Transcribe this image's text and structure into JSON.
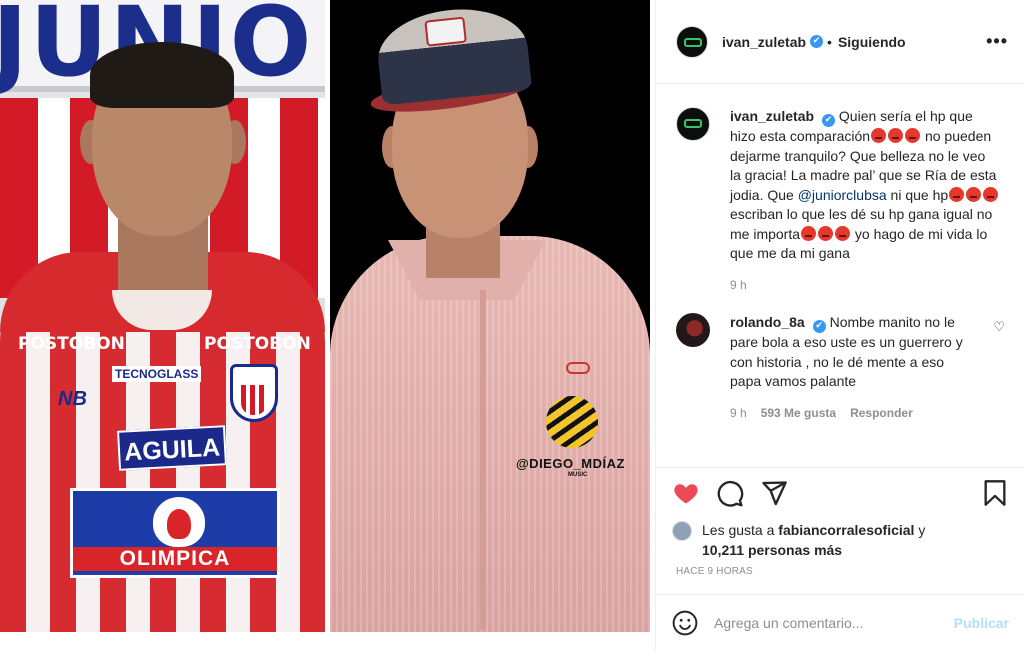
{
  "post_author": {
    "username": "ivan_zuletab",
    "verified_glyph": "✔",
    "separator": "•",
    "follow_status": "Siguiendo",
    "more_icon": "more-horizontal-icon"
  },
  "image": {
    "left_sign": "JUNIO",
    "sponsor_top_left": "POSTOBON",
    "sponsor_top_right": "POSTOBON",
    "sponsor_mid": "TECNOGLASS",
    "brand": "NB",
    "sponsor_chest": "AGUILA",
    "sponsor_main": "OLIMPICA",
    "watermark": "@DIEGO_MDÍAZ",
    "watermark_sub": "MUSIC"
  },
  "caption": {
    "username": "ivan_zuletab",
    "part1": "Quien sería el hp que hizo esta comparación",
    "part2": " no pueden dejarme tranquilo? Que belleza no le veo la gracia! La madre pal’ que se Ría de esta jodia. Que ",
    "mention": "@juniorclubsa",
    "part3": " ni que hp",
    "part4": " escriban lo que les dé su hp gana igual no me importa",
    "part5": " yo hago de mi vida lo que me da mi gana",
    "time": "9 h"
  },
  "comment": {
    "username": "rolando_8a",
    "text": "Nombe manito no le pare bola a eso uste es un guerrero y con historia , no le dé mente a eso papa vamos palante",
    "time": "9 h",
    "likes": "593 Me gusta",
    "reply": "Responder",
    "like_icon": "♡"
  },
  "actions": {
    "likes_prefix": "Les gusta a ",
    "likes_user": "fabiancorralesoficial",
    "likes_mid": " y",
    "likes_count": "10,211 personas más",
    "timestamp": "HACE 9 HORAS"
  },
  "add_comment": {
    "placeholder": "Agrega un comentario...",
    "publish": "Publicar"
  },
  "colors": {
    "like_red": "#ed4956",
    "link_blue": "#00376b",
    "verified_blue": "#3897f0",
    "publish_disabled": "#b2dffc"
  }
}
